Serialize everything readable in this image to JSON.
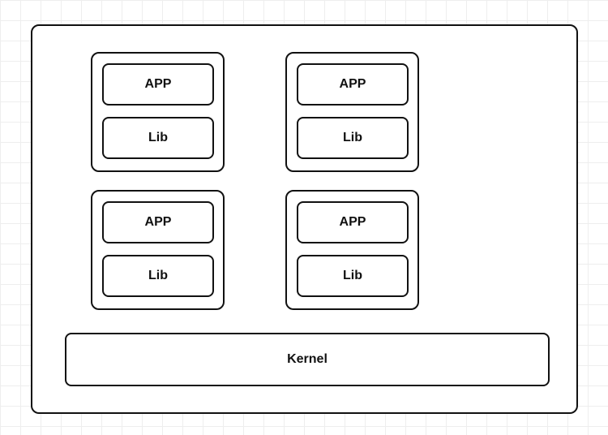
{
  "diagram": {
    "groups": [
      {
        "position": "tl",
        "app_label": "APP",
        "lib_label": "Lib"
      },
      {
        "position": "tr",
        "app_label": "APP",
        "lib_label": "Lib"
      },
      {
        "position": "bl",
        "app_label": "APP",
        "lib_label": "Lib"
      },
      {
        "position": "br",
        "app_label": "APP",
        "lib_label": "Lib"
      }
    ],
    "kernel_label": "Kernel"
  }
}
